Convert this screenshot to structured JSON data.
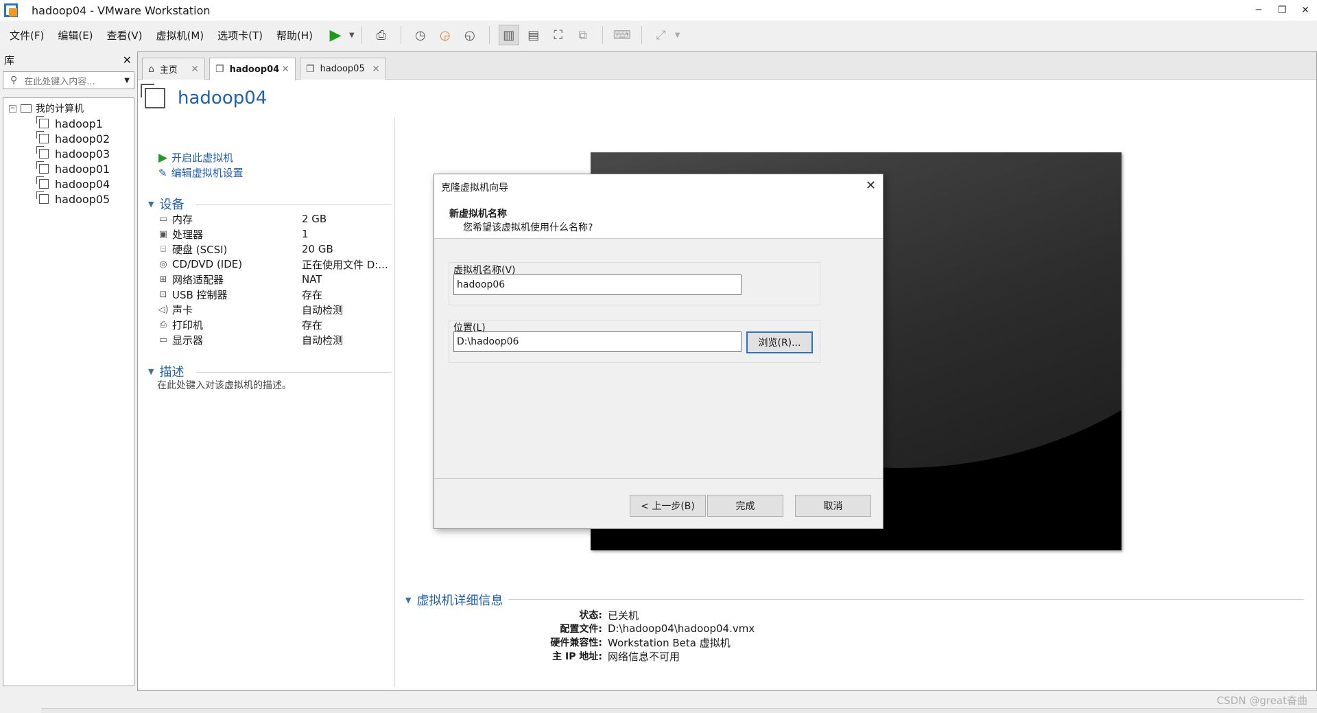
{
  "window": {
    "title": "hadoop04 - VMware Workstation"
  },
  "menu": [
    "文件(F)",
    "编辑(E)",
    "查看(V)",
    "虚拟机(M)",
    "选项卡(T)",
    "帮助(H)"
  ],
  "library": {
    "title": "库",
    "search_placeholder": "在此处键入内容...",
    "root_label": "我的计算机",
    "items": [
      "hadoop1",
      "hadoop02",
      "hadoop03",
      "hadoop01",
      "hadoop04",
      "hadoop05"
    ]
  },
  "tabs": [
    {
      "label": "主页"
    },
    {
      "label": "hadoop04"
    },
    {
      "label": "hadoop05"
    }
  ],
  "vm": {
    "name": "hadoop04",
    "actions": [
      "开启此虚拟机",
      "编辑虚拟机设置"
    ],
    "devices_title": "设备",
    "devices": [
      {
        "name": "内存",
        "value": "2 GB"
      },
      {
        "name": "处理器",
        "value": "1"
      },
      {
        "name": "硬盘 (SCSI)",
        "value": "20 GB"
      },
      {
        "name": "CD/DVD (IDE)",
        "value": "正在使用文件 D:..."
      },
      {
        "name": "网络适配器",
        "value": "NAT"
      },
      {
        "name": "USB 控制器",
        "value": "存在"
      },
      {
        "name": "声卡",
        "value": "自动检测"
      },
      {
        "name": "打印机",
        "value": "存在"
      },
      {
        "name": "显示器",
        "value": "自动检测"
      }
    ],
    "description_title": "描述",
    "description_placeholder": "在此处键入对该虚拟机的描述。",
    "details_title": "虚拟机详细信息",
    "details": [
      {
        "label": "状态:",
        "value": "已关机"
      },
      {
        "label": "配置文件:",
        "value": "D:\\hadoop04\\hadoop04.vmx"
      },
      {
        "label": "硬件兼容性:",
        "value": "Workstation Beta 虚拟机"
      },
      {
        "label": "主 IP 地址:",
        "value": "网络信息不可用"
      }
    ]
  },
  "dialog": {
    "title": "克隆虚拟机向导",
    "heading": "新虚拟机名称",
    "subheading": "您希望该虚拟机使用什么名称?",
    "name_label": "虚拟机名称(V)",
    "name_value": "hadoop06",
    "location_label": "位置(L)",
    "location_value": "D:\\hadoop06",
    "browse_label": "浏览(R)...",
    "back_label": "< 上一步(B)",
    "finish_label": "完成",
    "cancel_label": "取消"
  },
  "watermark": "CSDN @great奋曲",
  "colors": {
    "link_blue": "#1f5fb4",
    "play_green": "#1a9e1a",
    "focus_border": "#2f73c6"
  }
}
